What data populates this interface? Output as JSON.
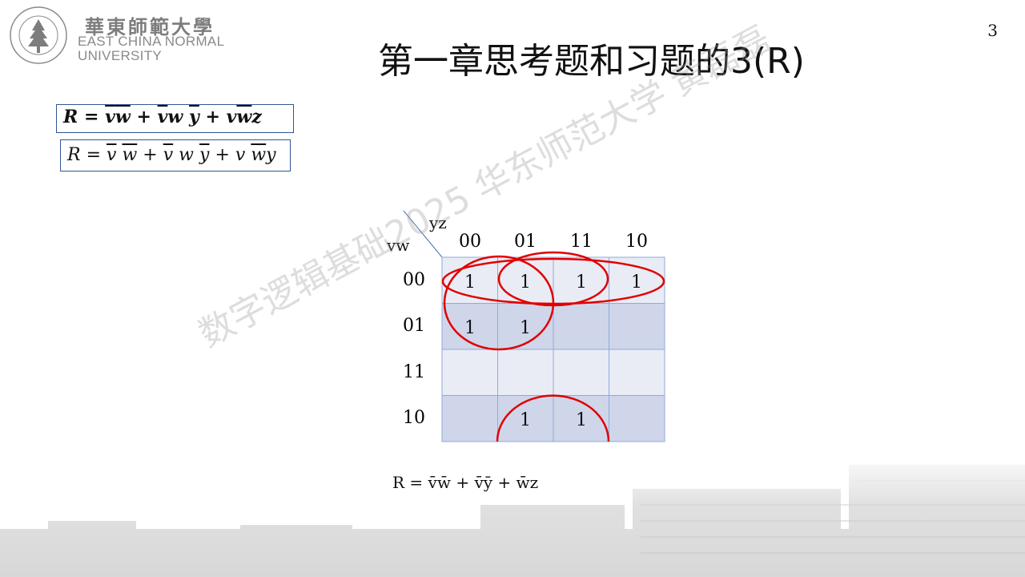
{
  "logo": {
    "cn": "華東師範大學",
    "en_line1": "EAST CHINA NORMAL",
    "en_line2": "UNIVERSITY",
    "seal_text": "EAST CHINA NORMAL UNIVERSITY"
  },
  "page_number": "3",
  "title": "第一章思考题和习题的3(R)",
  "formula1": {
    "parts": [
      "R",
      "=",
      "v",
      "w",
      "+",
      "v",
      "w",
      "y",
      "+",
      "v",
      "w",
      "z"
    ]
  },
  "formula2": {
    "parts": [
      "R",
      "=",
      "v",
      "w",
      "+",
      "v",
      "w",
      "y",
      "+",
      "v",
      "w",
      "y"
    ]
  },
  "kmap": {
    "corner_col_var": "yz",
    "corner_row_var": "vw",
    "col_headers": [
      "00",
      "01",
      "11",
      "10"
    ],
    "row_headers": [
      "00",
      "01",
      "11",
      "10"
    ],
    "cells": [
      [
        "1",
        "1",
        "1",
        "1"
      ],
      [
        "1",
        "1",
        "",
        ""
      ],
      [
        "",
        "",
        "",
        ""
      ],
      [
        "",
        "1",
        "1",
        ""
      ]
    ],
    "colors": {
      "light": "#e9ecf5",
      "dark": "#cfd6ea",
      "border": "#8faadc",
      "loop": "#e00000"
    }
  },
  "result": {
    "lhs": "R",
    "eq": "=",
    "t1": "v̄w̄",
    "plus1": "+",
    "t2": "v̄ȳ",
    "plus2": "+",
    "t3": "w̄z"
  },
  "watermark": "数字逻辑基础2025 华东师范大学 黄磊磊"
}
